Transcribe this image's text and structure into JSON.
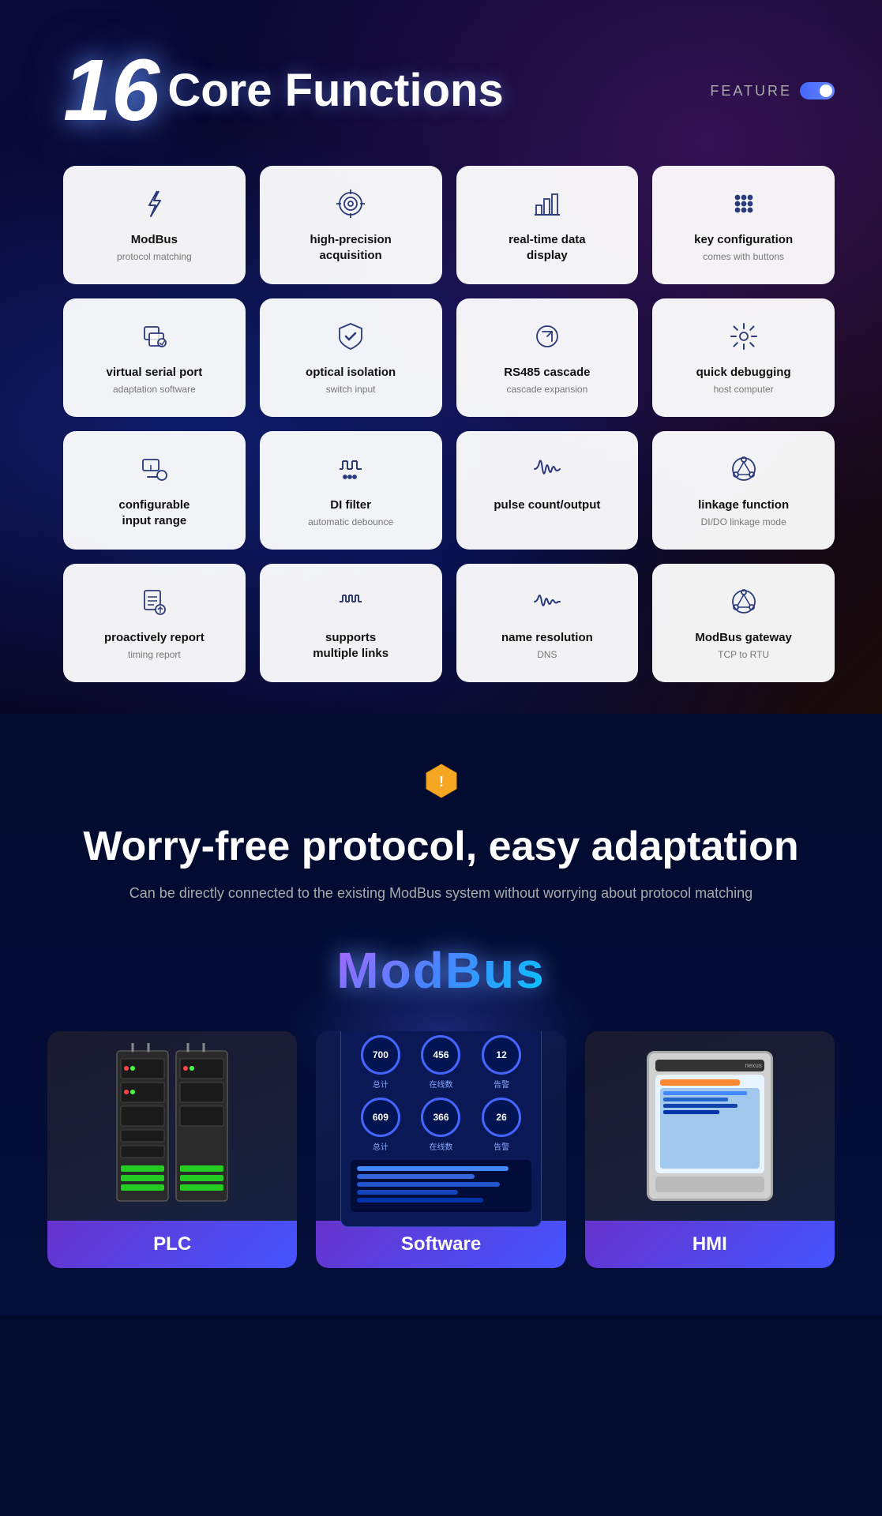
{
  "header": {
    "title_num": "16",
    "title_text": "Core Functions",
    "feature_label": "FEATURE"
  },
  "cards": [
    {
      "id": "modbus",
      "icon": "lightning",
      "title": "ModBus",
      "sub": "protocol matching"
    },
    {
      "id": "high-precision",
      "icon": "target",
      "title": "high-precision acquisition",
      "sub": ""
    },
    {
      "id": "realtime-data",
      "icon": "bar-chart",
      "title": "real-time data display",
      "sub": ""
    },
    {
      "id": "key-config",
      "icon": "grid",
      "title": "key configuration",
      "sub": "comes with buttons"
    },
    {
      "id": "virtual-serial",
      "icon": "layers",
      "title": "virtual serial port",
      "sub": "adaptation software"
    },
    {
      "id": "optical-isolation",
      "icon": "shield",
      "title": "optical isolation",
      "sub": "switch input"
    },
    {
      "id": "rs485",
      "icon": "refresh",
      "title": "RS485 cascade",
      "sub": "cascade expansion"
    },
    {
      "id": "quick-debug",
      "icon": "settings",
      "title": "quick debugging",
      "sub": "host computer"
    },
    {
      "id": "configurable",
      "icon": "sliders",
      "title": "configurable input range",
      "sub": ""
    },
    {
      "id": "di-filter",
      "icon": "waveform",
      "title": "DI filter",
      "sub": "automatic debounce"
    },
    {
      "id": "pulse",
      "icon": "pulse",
      "title": "pulse count/output",
      "sub": ""
    },
    {
      "id": "linkage",
      "icon": "circle-nodes",
      "title": "linkage function",
      "sub": "DI/DO linkage mode"
    },
    {
      "id": "proactive",
      "icon": "sliders2",
      "title": "proactively report",
      "sub": "timing report"
    },
    {
      "id": "multiple-links",
      "icon": "waveform2",
      "title": "supports multiple links",
      "sub": ""
    },
    {
      "id": "dns",
      "icon": "pulse2",
      "title": "name resolution",
      "sub": "DNS"
    },
    {
      "id": "modbus-gw",
      "icon": "circle-nodes2",
      "title": "ModBus gateway",
      "sub": "TCP to RTU"
    }
  ],
  "protocol": {
    "title": "Worry-free protocol, easy adaptation",
    "sub": "Can be directly connected to the existing ModBus system without worrying about protocol matching",
    "logo": "ModBus"
  },
  "devices": [
    {
      "label": "PLC"
    },
    {
      "label": "Software"
    },
    {
      "label": "HMI"
    }
  ]
}
